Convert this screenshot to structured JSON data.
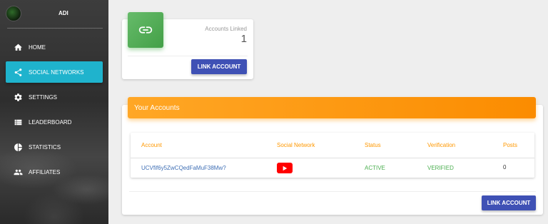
{
  "sidebar": {
    "user": {
      "name": "ADI"
    },
    "items": [
      {
        "label": "HOME",
        "icon": "home-icon"
      },
      {
        "label": "SOCIAL NETWORKS",
        "icon": "share-icon",
        "active": true
      },
      {
        "label": "SETTINGS",
        "icon": "gear-icon"
      },
      {
        "label": "LEADERBOARD",
        "icon": "list-icon"
      },
      {
        "label": "STATISTICS",
        "icon": "pie-chart-icon"
      },
      {
        "label": "AFFILIATES",
        "icon": "people-icon"
      }
    ]
  },
  "stats": {
    "label": "Accounts Linked",
    "value": "1",
    "button_label": "LINK ACCOUNT",
    "icon": "link-icon",
    "icon_color": "#4caf50"
  },
  "accounts": {
    "title": "Your Accounts",
    "header_color": "#ff9800",
    "columns": [
      "Account",
      "Social Network",
      "Status",
      "Verification",
      "Posts"
    ],
    "rows": [
      {
        "account": "UCVfif6y5ZwCQedFaMuF38Mw?",
        "network": "youtube-icon",
        "status": "ACTIVE",
        "verification": "VERIFIED",
        "posts": "0"
      }
    ],
    "button_label": "LINK ACCOUNT"
  },
  "colors": {
    "accent": "#3f51b5",
    "active_nav": "#1fb3cd",
    "status_ok": "#4caf50"
  }
}
